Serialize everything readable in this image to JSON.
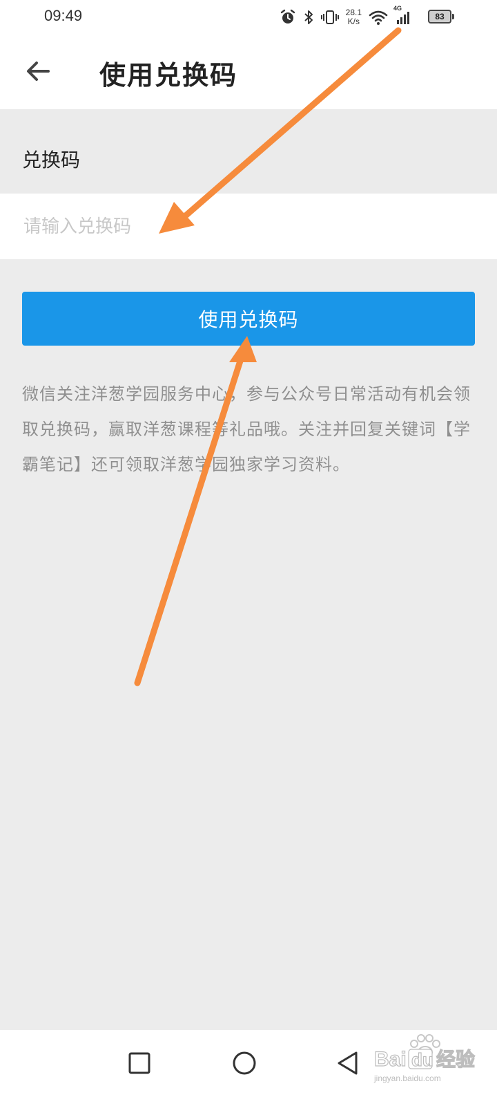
{
  "status_bar": {
    "time": "09:49",
    "net_speed_value": "28.1",
    "net_speed_unit": "K/s",
    "network_type": "4G",
    "battery": "83"
  },
  "header": {
    "title": "使用兑换码",
    "back_icon": "arrow-left-icon"
  },
  "form": {
    "section_label": "兑换码",
    "input_placeholder": "请输入兑换码",
    "input_value": "",
    "submit_label": "使用兑换码",
    "button_color": "#1a96e8"
  },
  "description": "微信关注洋葱学园服务中心，参与公众号日常活动有机会领取兑换码，赢取洋葱课程等礼品哦。关注并回复关键词【学霸笔记】还可领取洋葱学园独家学习资料。",
  "nav_bar": {
    "recents_icon": "square-icon",
    "home_icon": "circle-icon",
    "back_icon": "triangle-back-icon"
  },
  "watermark": {
    "brand": "Baidu经验",
    "domain": "jingyan.baidu.com"
  },
  "annotations": {
    "arrow_color": "#f68b3c"
  }
}
